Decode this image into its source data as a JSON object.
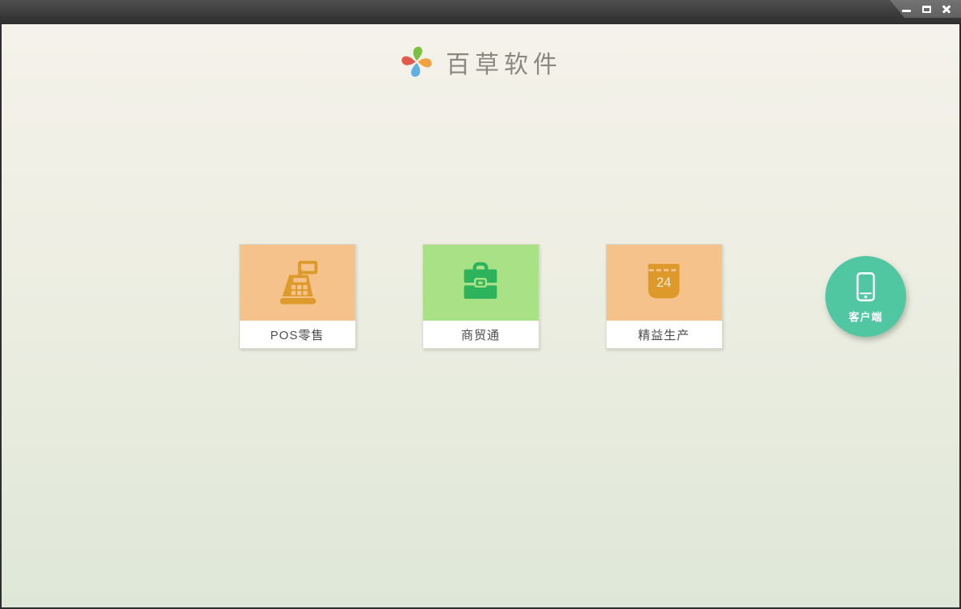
{
  "window": {
    "controls": {
      "minimize_icon": "minimize-icon",
      "maximize_icon": "maximize-icon",
      "close_icon": "close-icon"
    }
  },
  "header": {
    "app_title": "百草软件",
    "logo_icon": "pinwheel-logo",
    "logo_colors": {
      "top": "#7cc142",
      "right": "#f2a341",
      "bottom": "#5fb0e5",
      "left": "#e25a4e"
    }
  },
  "products": [
    {
      "label": "POS零售",
      "icon": "cash-register-icon",
      "bg": "#f5c28b",
      "icon_color": "#de9b2d"
    },
    {
      "label": "商贸通",
      "icon": "briefcase-icon",
      "bg": "#a9e187",
      "icon_color": "#2cb35b"
    },
    {
      "label": "精益生产",
      "icon": "calendar-icon",
      "bg": "#f5c28b",
      "icon_color": "#dd9a2a",
      "calendar_day": "24"
    }
  ],
  "client_button": {
    "label": "客户端",
    "icon": "smartphone-icon",
    "bg": "#51c7a1"
  },
  "theme": {
    "titlebar_color": "#3c3c3c",
    "background_top": "#f4f2ea",
    "background_bottom": "#dfe7d8",
    "card_label_color": "#4d4d4d",
    "title_color": "#8a897f"
  }
}
